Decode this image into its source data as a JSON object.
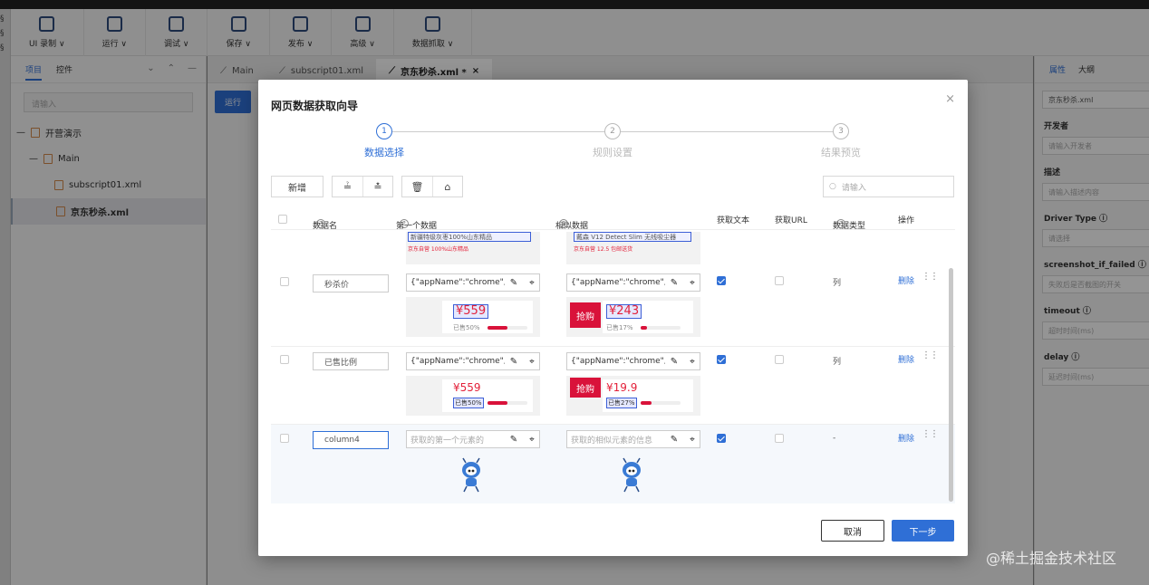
{
  "toolbar": {
    "items": [
      {
        "label": "UI 录制 ∨",
        "icon": "monitor-icon"
      },
      {
        "label": "运行 ∨",
        "icon": "play-icon"
      },
      {
        "label": "调试 ∨",
        "icon": "debug-icon"
      },
      {
        "label": "保存 ∨",
        "icon": "save-icon"
      },
      {
        "label": "发布 ∨",
        "icon": "send-icon"
      },
      {
        "label": "高级 ∨",
        "icon": "layers-icon"
      },
      {
        "label": "数据抓取 ∨",
        "icon": "grid-icon"
      }
    ]
  },
  "left_panel": {
    "tabs": [
      "项目",
      "控件"
    ],
    "search_placeholder": "请输入",
    "tree": [
      {
        "label": "开营演示",
        "prefix": "—"
      },
      {
        "label": "Main",
        "prefix": "—"
      },
      {
        "label": "subscript01.xml",
        "prefix": ""
      },
      {
        "label": "京东秒杀.xml",
        "prefix": ""
      }
    ]
  },
  "editor": {
    "tabs": [
      {
        "label": "Main"
      },
      {
        "label": "subscript01.xml"
      },
      {
        "label": "京东秒杀.xml *"
      }
    ],
    "run_label": "运行"
  },
  "right_panel": {
    "tabs": [
      "属性",
      "大纲"
    ],
    "top_value": "京东秒杀.xml",
    "fields": [
      {
        "label": "开发者",
        "placeholder": "请输入开发者"
      },
      {
        "label": "描述",
        "placeholder": "请输入描述内容"
      },
      {
        "label": "Driver Type ⓘ",
        "placeholder": "请选择"
      },
      {
        "label": "screenshot_if_failed ⓘ",
        "placeholder": "失败后是否截图的开关"
      },
      {
        "label": "timeout ⓘ",
        "placeholder": "超时时间(ms)"
      },
      {
        "label": "delay ⓘ",
        "placeholder": "延迟时间(ms)"
      }
    ]
  },
  "dialog": {
    "title": "网页数据获取向导",
    "steps": [
      {
        "num": "1",
        "label": "数据选择"
      },
      {
        "num": "2",
        "label": "规则设置"
      },
      {
        "num": "3",
        "label": "结果预览"
      }
    ],
    "new_button": "新增",
    "search_placeholder": "请输入",
    "columns": [
      "数据名",
      "第一个数据",
      "相似数据",
      "获取文本",
      "获取URL",
      "数据类型",
      "操作"
    ],
    "partial_row": {
      "first": "新疆特级灰枣100%山东精品",
      "first_sub": "京东自营 100%山东精品",
      "similar": "戴森 V12 Detect Slim 无线吸尘器",
      "similar_sub": "京东自营 12.5 包邮送货"
    },
    "rows": [
      {
        "name": "秒杀价",
        "first_value": "{\"appName\":\"chrome\",",
        "similar_value": "{\"appName\":\"chrome\",",
        "first_price": "¥559",
        "first_sold": "已售50%",
        "first_progress": 0.5,
        "similar_tag": "抢购",
        "similar_price": "¥243",
        "similar_sold": "已售17%",
        "similar_progress": 0.17,
        "get_text": true,
        "get_url": false,
        "type": "列",
        "op": "删除"
      },
      {
        "name": "已售比例",
        "first_value": "{\"appName\":\"chrome\",",
        "similar_value": "{\"appName\":\"chrome\",",
        "first_price": "¥559",
        "first_sold": "已售50%",
        "first_progress": 0.5,
        "similar_tag": "抢购",
        "similar_price": "¥19.9",
        "similar_sold": "已售27%",
        "similar_progress": 0.27,
        "get_text": true,
        "get_url": false,
        "type": "列",
        "op": "删除"
      },
      {
        "name": "column4",
        "first_placeholder": "获取的第一个元素的",
        "similar_placeholder": "获取的相似元素的信息",
        "get_text": true,
        "get_url": false,
        "type": "-",
        "op": "删除"
      }
    ],
    "cancel": "取消",
    "next": "下一步"
  },
  "watermark": "@稀土掘金技术社区",
  "colors": {
    "primary": "#2f6fd6",
    "price_red": "#e3213a"
  }
}
